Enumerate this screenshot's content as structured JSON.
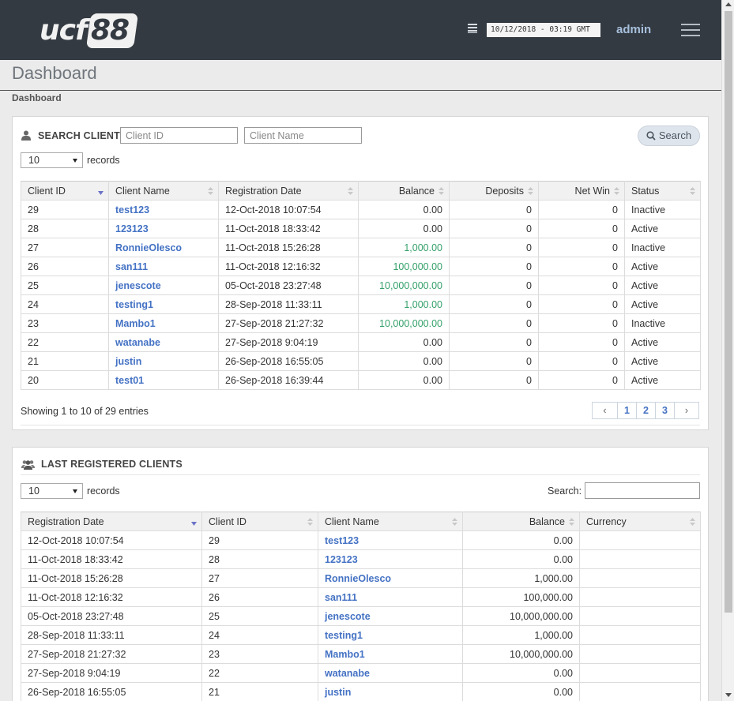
{
  "header": {
    "logo_left": "ucf",
    "logo_right": "88",
    "datetime": "10/12/2018 - 03:19 GMT",
    "user": "admin"
  },
  "page": {
    "title": "Dashboard",
    "breadcrumb": "Dashboard"
  },
  "search_client": {
    "title": "SEARCH CLIENT",
    "client_id_placeholder": "Client ID",
    "client_name_placeholder": "Client Name",
    "search_label": "Search",
    "page_size": "10",
    "records_label": "records",
    "columns": [
      "Client ID",
      "Client Name",
      "Registration Date",
      "Balance",
      "Deposits",
      "Net Win",
      "Status"
    ],
    "rows": [
      {
        "id": "29",
        "name": "test123",
        "date": "12-Oct-2018 10:07:54",
        "balance": "0.00",
        "deposits": "0",
        "netwin": "0",
        "status": "Inactive",
        "positive": false
      },
      {
        "id": "28",
        "name": "123123",
        "date": "11-Oct-2018 18:33:42",
        "balance": "0.00",
        "deposits": "0",
        "netwin": "0",
        "status": "Active",
        "positive": false
      },
      {
        "id": "27",
        "name": "RonnieOlesco",
        "date": "11-Oct-2018 15:26:28",
        "balance": "1,000.00",
        "deposits": "0",
        "netwin": "0",
        "status": "Inactive",
        "positive": true
      },
      {
        "id": "26",
        "name": "san111",
        "date": "11-Oct-2018 12:16:32",
        "balance": "100,000.00",
        "deposits": "0",
        "netwin": "0",
        "status": "Active",
        "positive": true
      },
      {
        "id": "25",
        "name": "jenescote",
        "date": "05-Oct-2018 23:27:48",
        "balance": "10,000,000.00",
        "deposits": "0",
        "netwin": "0",
        "status": "Active",
        "positive": true
      },
      {
        "id": "24",
        "name": "testing1",
        "date": "28-Sep-2018 11:33:11",
        "balance": "1,000.00",
        "deposits": "0",
        "netwin": "0",
        "status": "Active",
        "positive": true
      },
      {
        "id": "23",
        "name": "Mambo1",
        "date": "27-Sep-2018 21:27:32",
        "balance": "10,000,000.00",
        "deposits": "0",
        "netwin": "0",
        "status": "Inactive",
        "positive": true
      },
      {
        "id": "22",
        "name": "watanabe",
        "date": "27-Sep-2018 9:04:19",
        "balance": "0.00",
        "deposits": "0",
        "netwin": "0",
        "status": "Active",
        "positive": false
      },
      {
        "id": "21",
        "name": "justin",
        "date": "26-Sep-2018 16:55:05",
        "balance": "0.00",
        "deposits": "0",
        "netwin": "0",
        "status": "Active",
        "positive": false
      },
      {
        "id": "20",
        "name": "test01",
        "date": "26-Sep-2018 16:39:44",
        "balance": "0.00",
        "deposits": "0",
        "netwin": "0",
        "status": "Active",
        "positive": false
      }
    ],
    "showing": "Showing 1 to 10 of 29 entries",
    "pager": {
      "prev": "‹",
      "pages": [
        "1",
        "2",
        "3"
      ],
      "next": "›"
    }
  },
  "last_registered": {
    "title": "LAST REGISTERED CLIENTS",
    "page_size": "10",
    "records_label": "records",
    "search_label": "Search:",
    "columns": [
      "Registration Date",
      "Client ID",
      "Client Name",
      "Balance",
      "Currency"
    ],
    "rows": [
      {
        "date": "12-Oct-2018 10:07:54",
        "id": "29",
        "name": "test123",
        "balance": "0.00",
        "currency": ""
      },
      {
        "date": "11-Oct-2018 18:33:42",
        "id": "28",
        "name": "123123",
        "balance": "0.00",
        "currency": ""
      },
      {
        "date": "11-Oct-2018 15:26:28",
        "id": "27",
        "name": "RonnieOlesco",
        "balance": "1,000.00",
        "currency": ""
      },
      {
        "date": "11-Oct-2018 12:16:32",
        "id": "26",
        "name": "san111",
        "balance": "100,000.00",
        "currency": ""
      },
      {
        "date": "05-Oct-2018 23:27:48",
        "id": "25",
        "name": "jenescote",
        "balance": "10,000,000.00",
        "currency": ""
      },
      {
        "date": "28-Sep-2018 11:33:11",
        "id": "24",
        "name": "testing1",
        "balance": "1,000.00",
        "currency": ""
      },
      {
        "date": "27-Sep-2018 21:27:32",
        "id": "23",
        "name": "Mambo1",
        "balance": "10,000,000.00",
        "currency": ""
      },
      {
        "date": "27-Sep-2018 9:04:19",
        "id": "22",
        "name": "watanabe",
        "balance": "0.00",
        "currency": ""
      },
      {
        "date": "26-Sep-2018 16:55:05",
        "id": "21",
        "name": "justin",
        "balance": "0.00",
        "currency": ""
      }
    ]
  },
  "colors": {
    "topbar": "#343a42",
    "link": "#4472c4",
    "positive_balance": "#35a16a",
    "admin": "#a7c0dc"
  }
}
